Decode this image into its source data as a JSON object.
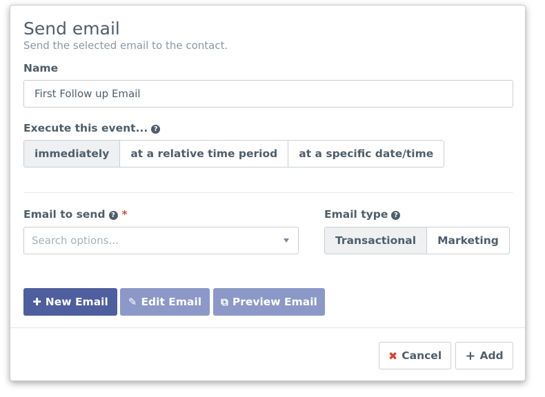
{
  "dialog": {
    "title": "Send email",
    "subtitle": "Send the selected email to the contact."
  },
  "name_field": {
    "label": "Name",
    "value": "First Follow up Email"
  },
  "execute": {
    "label": "Execute this event...",
    "options": [
      {
        "label": "immediately",
        "active": true
      },
      {
        "label": "at a relative time period",
        "active": false
      },
      {
        "label": "at a specific date/time",
        "active": false
      }
    ]
  },
  "email_to_send": {
    "label": "Email to send",
    "required_marker": "*",
    "placeholder": "Search options..."
  },
  "email_type": {
    "label": "Email type",
    "options": [
      {
        "label": "Transactional",
        "active": true
      },
      {
        "label": "Marketing",
        "active": false
      }
    ]
  },
  "actions": {
    "new_email": "New Email",
    "edit_email": "Edit Email",
    "preview_email": "Preview Email"
  },
  "footer": {
    "cancel": "Cancel",
    "add": "Add"
  },
  "icons": {
    "help": "question-circle-icon",
    "plus": "plus-icon",
    "edit": "edit-icon",
    "external": "external-link-icon",
    "close": "close-icon",
    "caret": "caret-down-icon"
  },
  "colors": {
    "primary": "#4e5e9e",
    "primary_disabled": "#8c98c7",
    "danger": "#e0432e",
    "text": "#4e5e6a"
  }
}
